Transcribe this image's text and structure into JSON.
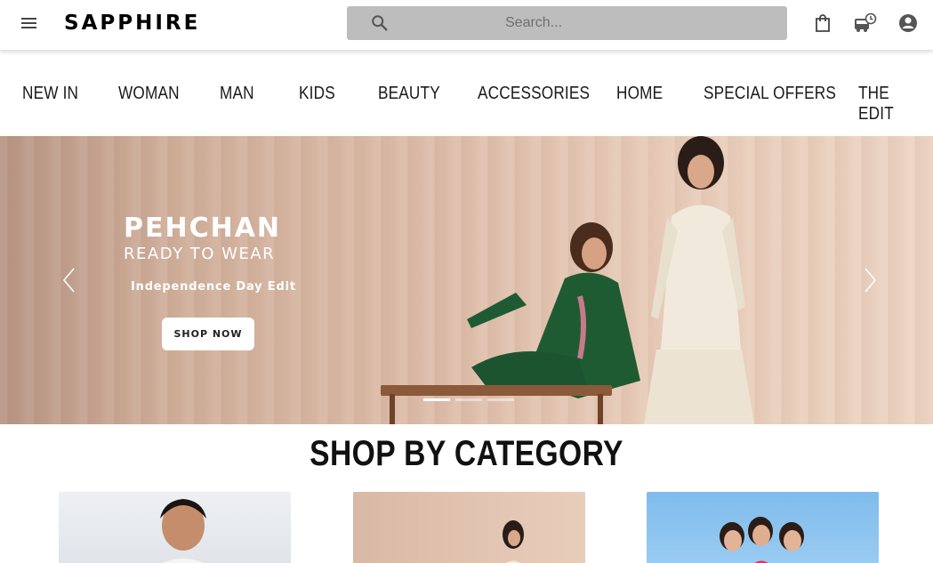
{
  "header": {
    "logo": "SAPPHIRE",
    "search_placeholder": "Search...",
    "icons": [
      "menu-icon",
      "search-icon",
      "shopping-bag-icon",
      "order-tracking-icon",
      "account-icon"
    ]
  },
  "nav": {
    "items": [
      "NEW IN",
      "WOMAN",
      "MAN",
      "KIDS",
      "BEAUTY",
      "ACCESSORIES",
      "HOME",
      "SPECIAL OFFERS",
      "THE EDIT"
    ]
  },
  "hero": {
    "title": "PEHCHAN",
    "subtitle": "READY TO WEAR",
    "tagline": "Independence Day Edit",
    "cta": "SHOP NOW",
    "slides_count": 3,
    "active_slide": 1
  },
  "category": {
    "title": "SHOP BY CATEGORY",
    "cards": [
      "man-category",
      "woman-category",
      "kids-category"
    ]
  },
  "colors": {
    "search_bg": "#bdbdbd",
    "hero_bg": "#dcbca8",
    "kids_bg": "#8cc4ef"
  }
}
